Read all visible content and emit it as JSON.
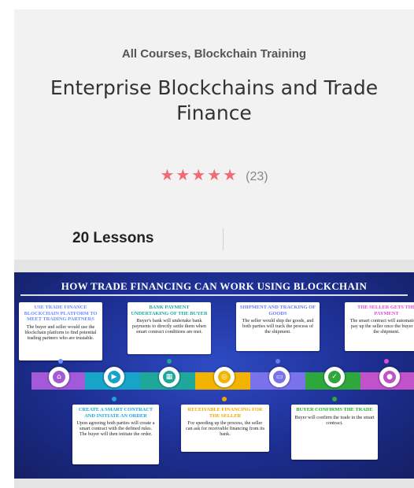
{
  "course": {
    "categories": "All Courses, Blockchain Training",
    "title": "Enterprise Blockchains and Trade Finance",
    "rating_stars": "★★★★★",
    "rating_count": "(23)",
    "lessons": "20 Lessons"
  },
  "thumbnail": {
    "title": "HOW TRADE FINANCING CAN WORK USING BLOCKCHAIN",
    "steps_top": [
      {
        "title": "USE TRADE FINANCE BLOCKCHAIN PLATFORM TO MEET TRADING PARTNERS",
        "text": "The buyer and seller would use the blockchain platform to find potential trading partners who are trustable.",
        "color": "#6a8dff"
      },
      {
        "title": "BANK PAYMENT UNDERTAKING OF THE BUYER",
        "text": "Buyer's bank will undertake bank payments to directly settle them when smart contract conditions are met.",
        "color": "#1fa89a"
      },
      {
        "title": "SHIPMENT AND TRACKING OF GOODS",
        "text": "The seller would ship the goods, and both parties will track the process of the shipment.",
        "color": "#6b7bf0"
      },
      {
        "title": "THE SELLER GETS THE PAYMENT",
        "text": "The smart contract will automatically pay up the seller once the buyer gets the shipment.",
        "color": "#d94fd6"
      }
    ],
    "steps_bottom": [
      {
        "title": "CREATE A SMART CONTRACT AND INITIATE AN ORDER",
        "text": "Upon agreeing both parties will create a smart contract with the defined rules. The buyer will then initiate the order.",
        "color": "#19a7d9"
      },
      {
        "title": "RECEIVABLE FINANCING FOR THE SELLER",
        "text": "For speeding up the process, the seller can ask for receivable financing from its bank.",
        "color": "#f2a500"
      },
      {
        "title": "BUYER CONFIRMS THE TRADE",
        "text": "Buyer will confirm the trade in the smart contract.",
        "color": "#2ea83a"
      }
    ]
  },
  "colors": {
    "star": "#ef6b73",
    "segments": [
      "#a45ad8",
      "#18a3c9",
      "#1fa89a",
      "#f2b400",
      "#7a72ea",
      "#2ea83a",
      "#c152c9"
    ]
  }
}
